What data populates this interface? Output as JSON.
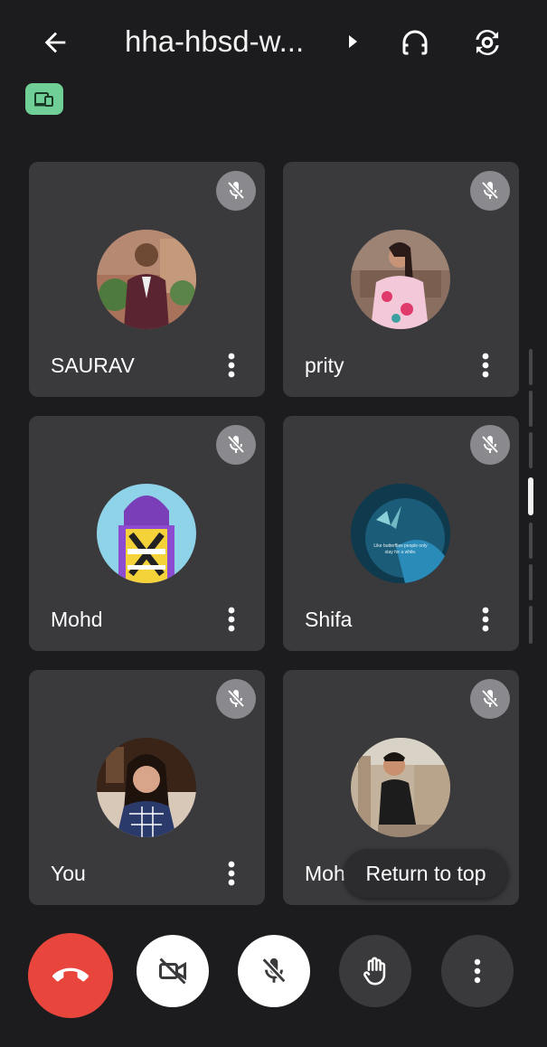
{
  "header": {
    "meeting_title": "hha-hbsd-w...",
    "back_icon": "arrow-back-icon",
    "audio_icon": "headphones-icon",
    "switch_camera_icon": "switch-camera-icon",
    "device_chip_icon": "devices-icon",
    "device_chip_color": "#6fcf97"
  },
  "participants": [
    {
      "name": "SAURAV",
      "muted": true
    },
    {
      "name": "prity",
      "muted": true
    },
    {
      "name": "Mohd",
      "muted": true
    },
    {
      "name": "Shifa",
      "muted": true
    },
    {
      "name": "You",
      "muted": true
    },
    {
      "name": "Mohd",
      "muted": true
    }
  ],
  "shifa_avatar_text": "Like butterflies people only stay for a while.",
  "return_to_top_label": "Return to top",
  "controls": {
    "end_call_icon": "phone-hangup-icon",
    "camera_icon": "camera-off-icon",
    "mic_icon": "mic-off-icon",
    "raise_hand_icon": "hand-icon",
    "more_icon": "more-vert-icon",
    "end_call_color": "#e8453c"
  }
}
